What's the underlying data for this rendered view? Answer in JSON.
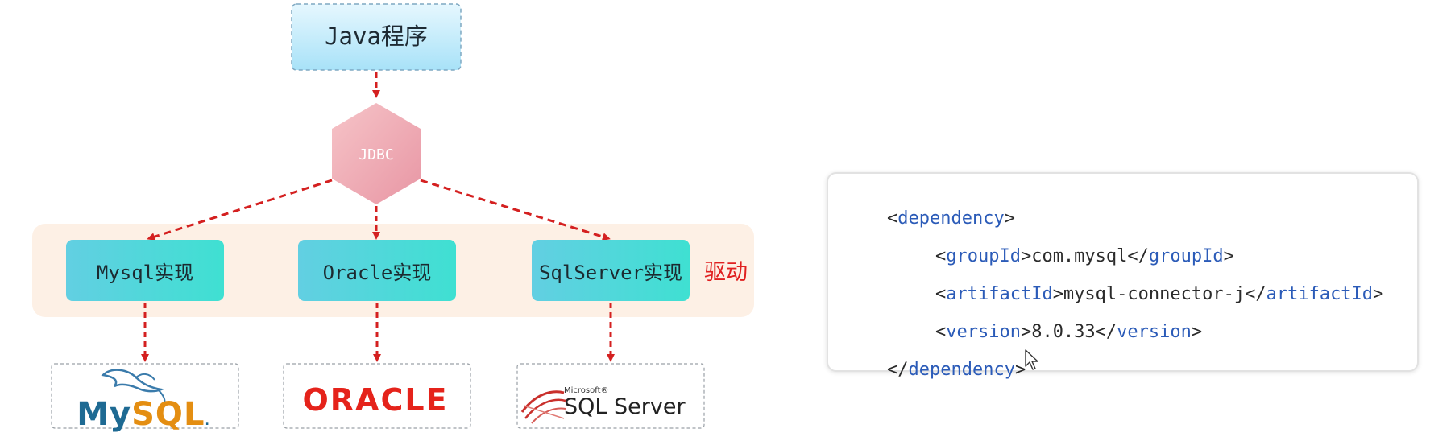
{
  "diagram": {
    "top_node": "Java程序",
    "hub": "JDBC",
    "implementations": [
      "Mysql实现",
      "Oracle实现",
      "SqlServer实现"
    ],
    "driver_label": "驱动",
    "logos": {
      "mysql": "MySQL",
      "oracle": "ORACLE",
      "sqlserver_small": "Microsoft®",
      "sqlserver": "SQL Server"
    },
    "colors": {
      "arrow": "#d42020",
      "impl_fill": "#4fd8dc",
      "top_fill": "#bfeafb",
      "hub_fill": "#f0b0b8",
      "band": "#fdeee0",
      "driver": "#e02020"
    }
  },
  "code": {
    "lines": [
      {
        "open": "<",
        "tag": "dependency",
        "close": ">"
      },
      {
        "open": "<",
        "tag": "groupId",
        "mid": ">com.mysql</",
        "tag2": "groupId",
        "close": ">"
      },
      {
        "open": "<",
        "tag": "artifactId",
        "mid": ">mysql-connector-j</",
        "tag2": "artifactId",
        "close": ">"
      },
      {
        "open": "<",
        "tag": "version",
        "mid": ">8.0.33</",
        "tag2": "version",
        "close": ">"
      },
      {
        "open": "</",
        "tag": "dependency",
        "close": ">"
      }
    ]
  }
}
